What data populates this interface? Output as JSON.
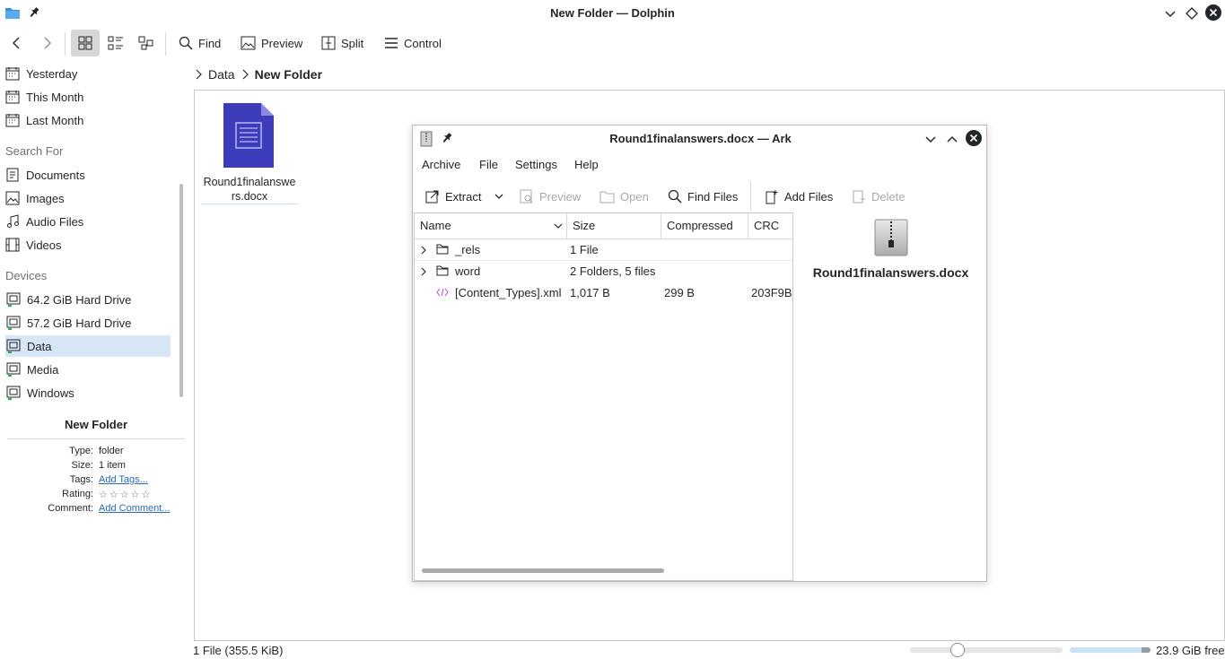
{
  "window": {
    "title": "New Folder — Dolphin"
  },
  "toolbar": {
    "find": "Find",
    "preview": "Preview",
    "split": "Split",
    "control": "Control"
  },
  "sidebar": {
    "recent": [
      "Yesterday",
      "This Month",
      "Last Month"
    ],
    "search_heading": "Search For",
    "search": [
      "Documents",
      "Images",
      "Audio Files",
      "Videos"
    ],
    "devices_heading": "Devices",
    "devices": [
      "64.2 GiB Hard Drive",
      "57.2 GiB Hard Drive",
      "Data",
      "Media",
      "Windows"
    ],
    "active_device": "Data"
  },
  "info_panel": {
    "title": "New Folder",
    "type_label": "Type:",
    "type_value": "folder",
    "size_label": "Size:",
    "size_value": "1 item",
    "tags_label": "Tags:",
    "tags_value": "Add Tags...",
    "rating_label": "Rating:",
    "rating_value": "☆☆☆☆☆",
    "comment_label": "Comment:",
    "comment_value": "Add Comment..."
  },
  "breadcrumb": [
    "Data",
    "New Folder"
  ],
  "files": [
    {
      "name_line1": "Round1finalanswe",
      "name_line2": "rs.docx"
    }
  ],
  "statusbar": {
    "summary": "1 File (355.5 KiB)",
    "free": "23.9 GiB free"
  },
  "ark": {
    "title": "Round1finalanswers.docx — Ark",
    "menu": [
      "Archive",
      "File",
      "Settings",
      "Help"
    ],
    "toolbar": {
      "extract": "Extract",
      "preview": "Preview",
      "open": "Open",
      "find_files": "Find Files",
      "add_files": "Add Files",
      "delete": "Delete"
    },
    "columns": [
      "Name",
      "Size",
      "Compressed",
      "CRC"
    ],
    "rows": [
      {
        "name": "_rels",
        "size": "1 File",
        "compressed": "",
        "crc": "",
        "kind": "folder"
      },
      {
        "name": "word",
        "size": "2 Folders, 5 files",
        "compressed": "",
        "crc": "",
        "kind": "folder"
      },
      {
        "name": "[Content_Types].xml",
        "size": "1,017 B",
        "compressed": "299 B",
        "crc": "203F9B",
        "kind": "xml"
      }
    ],
    "preview_name": "Round1finalanswers.docx"
  },
  "colors": {
    "accent": "#3daee9",
    "selection": "#d7e6f5",
    "doc_icon": "#3d3dbb",
    "link": "#2a6ab5"
  }
}
